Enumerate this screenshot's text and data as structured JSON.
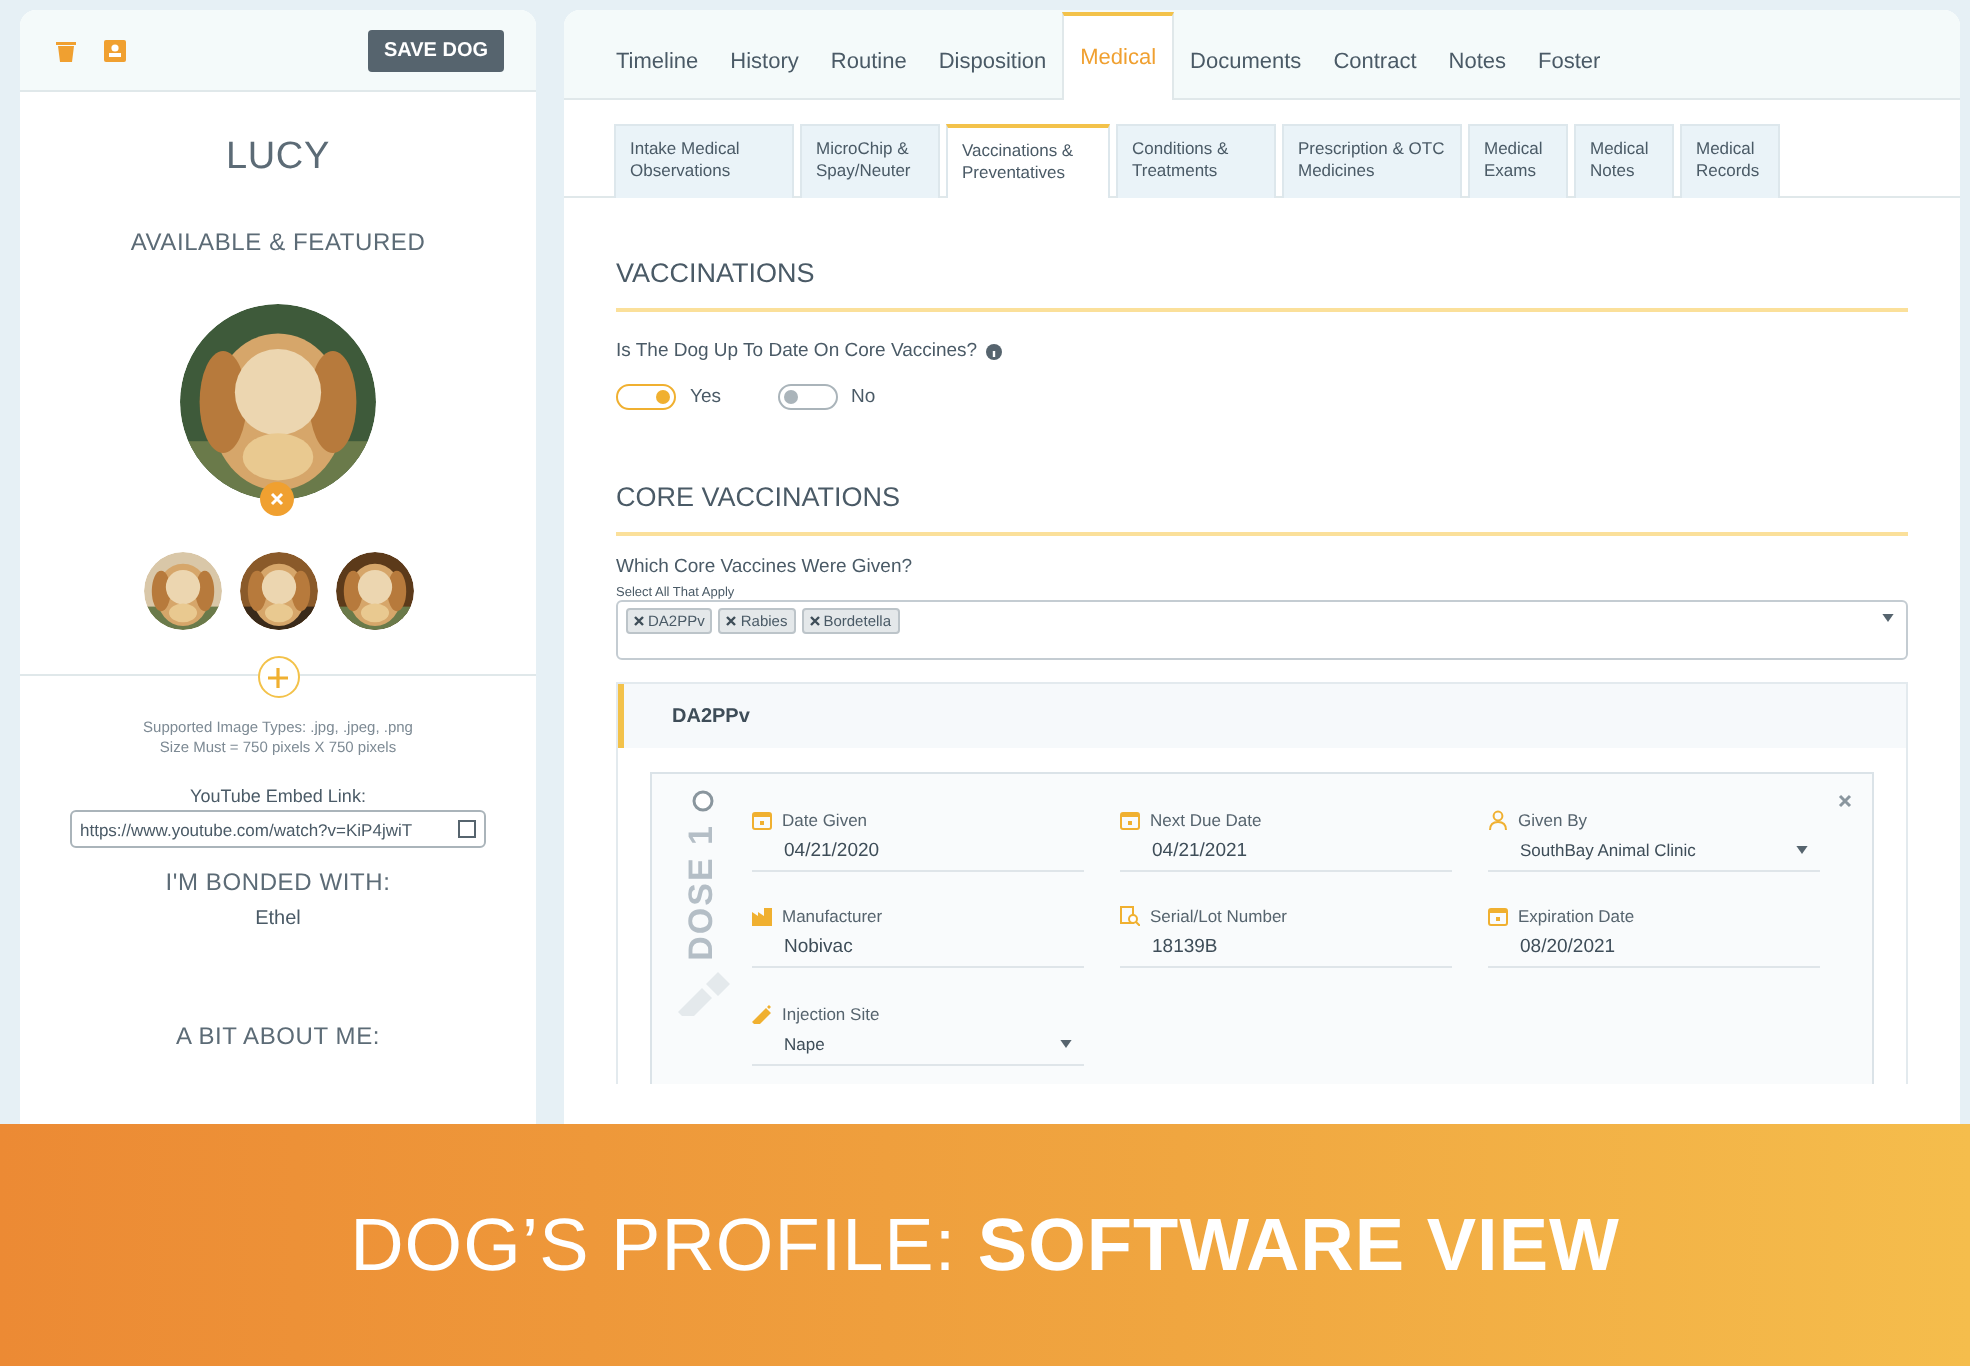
{
  "profile": {
    "save_button": "SAVE DOG",
    "name": "LUCY",
    "status": "AVAILABLE & FEATURED",
    "image_hint": [
      "Supported Image Types: .jpg, .jpeg, .png",
      "Size Must = 750 pixels X 750 pixels"
    ],
    "youtube_label": "YouTube Embed Link:",
    "youtube_value": "https://www.youtube.com/watch?v=KiP4jwiT",
    "bonded_heading": "I'M BONDED WITH:",
    "bonded_name": "Ethel",
    "about_heading": "A BIT ABOUT ME:"
  },
  "tabs": [
    {
      "label": "Timeline",
      "selected": false
    },
    {
      "label": "History",
      "selected": false
    },
    {
      "label": "Routine",
      "selected": false
    },
    {
      "label": "Disposition",
      "selected": false
    },
    {
      "label": "Medical",
      "selected": true
    },
    {
      "label": "Documents",
      "selected": false
    },
    {
      "label": "Contract",
      "selected": false
    },
    {
      "label": "Notes",
      "selected": false
    },
    {
      "label": "Foster",
      "selected": false
    }
  ],
  "subtabs": [
    {
      "label": "Intake Medical Observations",
      "selected": false
    },
    {
      "label": "MicroChip & Spay/Neuter",
      "selected": false
    },
    {
      "label": "Vaccinations & Preventatives",
      "selected": true
    },
    {
      "label": "Conditions & Treatments",
      "selected": false
    },
    {
      "label": "Prescription & OTC Medicines",
      "selected": false
    },
    {
      "label": "Medical Exams",
      "selected": false
    },
    {
      "label": "Medical Notes",
      "selected": false
    },
    {
      "label": "Medical Records",
      "selected": false
    }
  ],
  "vaccinations": {
    "title": "VACCINATIONS",
    "question": "Is The Dog Up To Date On Core Vaccines?",
    "options": [
      {
        "label": "Yes",
        "on": true
      },
      {
        "label": "No",
        "on": false
      }
    ]
  },
  "core": {
    "title": "CORE VACCINATIONS",
    "question": "Which Core Vaccines Were Given?",
    "hint": "Select All That Apply",
    "tags": [
      "DA2PPv",
      "Rabies",
      "Bordetella"
    ]
  },
  "vaccine_panel": {
    "title": "DA2PPv",
    "dose_label": "DOSE 1",
    "dose_selected": false,
    "fields": [
      {
        "label": "Date Given",
        "value": "04/21/2020",
        "kind": "date"
      },
      {
        "label": "Next Due Date",
        "value": "04/21/2021",
        "kind": "date"
      },
      {
        "label": "Given By",
        "value": "SouthBay Animal Clinic",
        "kind": "select"
      },
      {
        "label": "Manufacturer",
        "value": "Nobivac",
        "kind": "text"
      },
      {
        "label": "Serial/Lot Number",
        "value": "18139B",
        "kind": "text"
      },
      {
        "label": "Expiration Date",
        "value": "08/20/2021",
        "kind": "date"
      },
      {
        "label": "Injection Site",
        "value": "Nape",
        "kind": "select"
      }
    ]
  },
  "banner": "DOG’S PROFILE: **SOFTWARE VIEW**"
}
